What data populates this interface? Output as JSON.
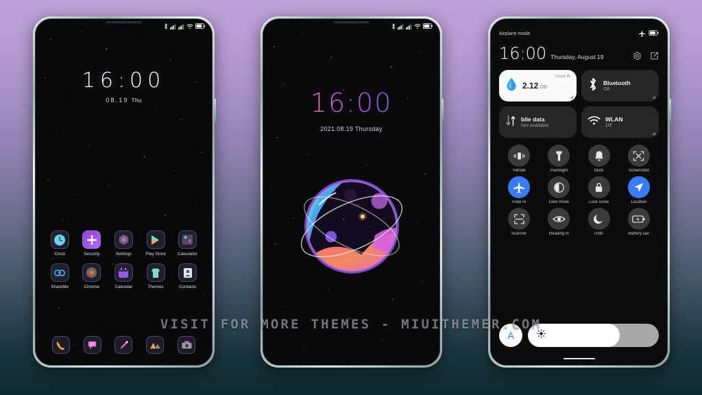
{
  "meta": {
    "watermark": "VISIT FOR MORE THEMES - MIUITHEMER.COM",
    "bg_top_color": "#bda0d8",
    "bg_bottom_color": "#0d2a2e",
    "accent_blue": "#3a7cf7"
  },
  "phone1": {
    "statusbar": {
      "icons": [
        "bluetooth-icon",
        "signal-icon",
        "signal-icon",
        "wifi-icon",
        "battery-icon"
      ]
    },
    "clock": "16:00",
    "date": "08.19",
    "weekday": "Thu",
    "apps": [
      {
        "label": "Clock",
        "icon": "clock-app-icon"
      },
      {
        "label": "Security",
        "icon": "security-app-icon"
      },
      {
        "label": "Settings",
        "icon": "settings-app-icon"
      },
      {
        "label": "Play Store",
        "icon": "play-store-app-icon"
      },
      {
        "label": "Calculator",
        "icon": "calculator-app-icon"
      },
      {
        "label": "ShareMe",
        "icon": "shareme-app-icon"
      },
      {
        "label": "Chrome",
        "icon": "chrome-app-icon"
      },
      {
        "label": "Calendar",
        "icon": "calendar-app-icon"
      },
      {
        "label": "Themes",
        "icon": "themes-app-icon"
      },
      {
        "label": "Contacts",
        "icon": "contacts-app-icon"
      }
    ],
    "dock": [
      {
        "label": "Phone",
        "icon": "phone-dock-icon"
      },
      {
        "label": "Messages",
        "icon": "messages-dock-icon"
      },
      {
        "label": "Themes",
        "icon": "brush-dock-icon"
      },
      {
        "label": "Gallery",
        "icon": "gallery-dock-icon"
      },
      {
        "label": "Camera",
        "icon": "camera-dock-icon"
      }
    ]
  },
  "phone2": {
    "statusbar": {
      "icons": [
        "bluetooth-icon",
        "signal-icon",
        "signal-icon",
        "wifi-icon",
        "battery-icon"
      ]
    },
    "clock": "16:00",
    "date": "2021.08.19 Thursday",
    "wallpaper": "planet-illustration"
  },
  "phone3": {
    "status_left": "Airplane mode",
    "status_right_icons": [
      "airplane-icon",
      "battery-icon"
    ],
    "time": "16:00",
    "date": "Thursday, August 19",
    "header_icons": [
      "settings-gear-icon",
      "edit-icon"
    ],
    "big_tiles": [
      {
        "title": "2.12",
        "unit": "GB",
        "sub": "Used th",
        "icon": "data-drop-icon",
        "state": "white",
        "resize": true
      },
      {
        "title": "Bluetooth",
        "sub": "Off",
        "icon": "bluetooth-icon",
        "state": "dark",
        "resize": true
      },
      {
        "title": "bile data",
        "sub": "Not available",
        "icon": "mobile-data-icon",
        "state": "dark",
        "resize": false
      },
      {
        "title": "WLAN",
        "sub": "Off",
        "icon": "wifi-icon",
        "state": "dark",
        "resize": true
      }
    ],
    "toggles": [
      {
        "label": "Vibrate",
        "icon": "vibrate-icon",
        "on": false
      },
      {
        "label": "Flashlight",
        "icon": "flashlight-icon",
        "on": false
      },
      {
        "label": "Mute",
        "icon": "bell-icon",
        "on": false
      },
      {
        "label": "Screenshot",
        "icon": "screenshot-icon",
        "on": false
      },
      {
        "label": "node    Ai",
        "icon": "airplane-icon",
        "on": true
      },
      {
        "label": "Dark mode",
        "icon": "dark-mode-icon",
        "on": false
      },
      {
        "label": "Lock scree",
        "icon": "lock-icon",
        "on": false
      },
      {
        "label": "Location",
        "icon": "location-icon",
        "on": true
      },
      {
        "label": "Scanner",
        "icon": "scanner-icon",
        "on": false
      },
      {
        "label": "Reading m",
        "icon": "eye-icon",
        "on": false
      },
      {
        "label": "DND",
        "icon": "moon-icon",
        "on": false
      },
      {
        "label": "Battery sav",
        "icon": "battery-save-icon",
        "on": false
      }
    ],
    "brightness": {
      "auto_label": "A",
      "level_percent": 70,
      "icon": "brightness-icon"
    }
  }
}
